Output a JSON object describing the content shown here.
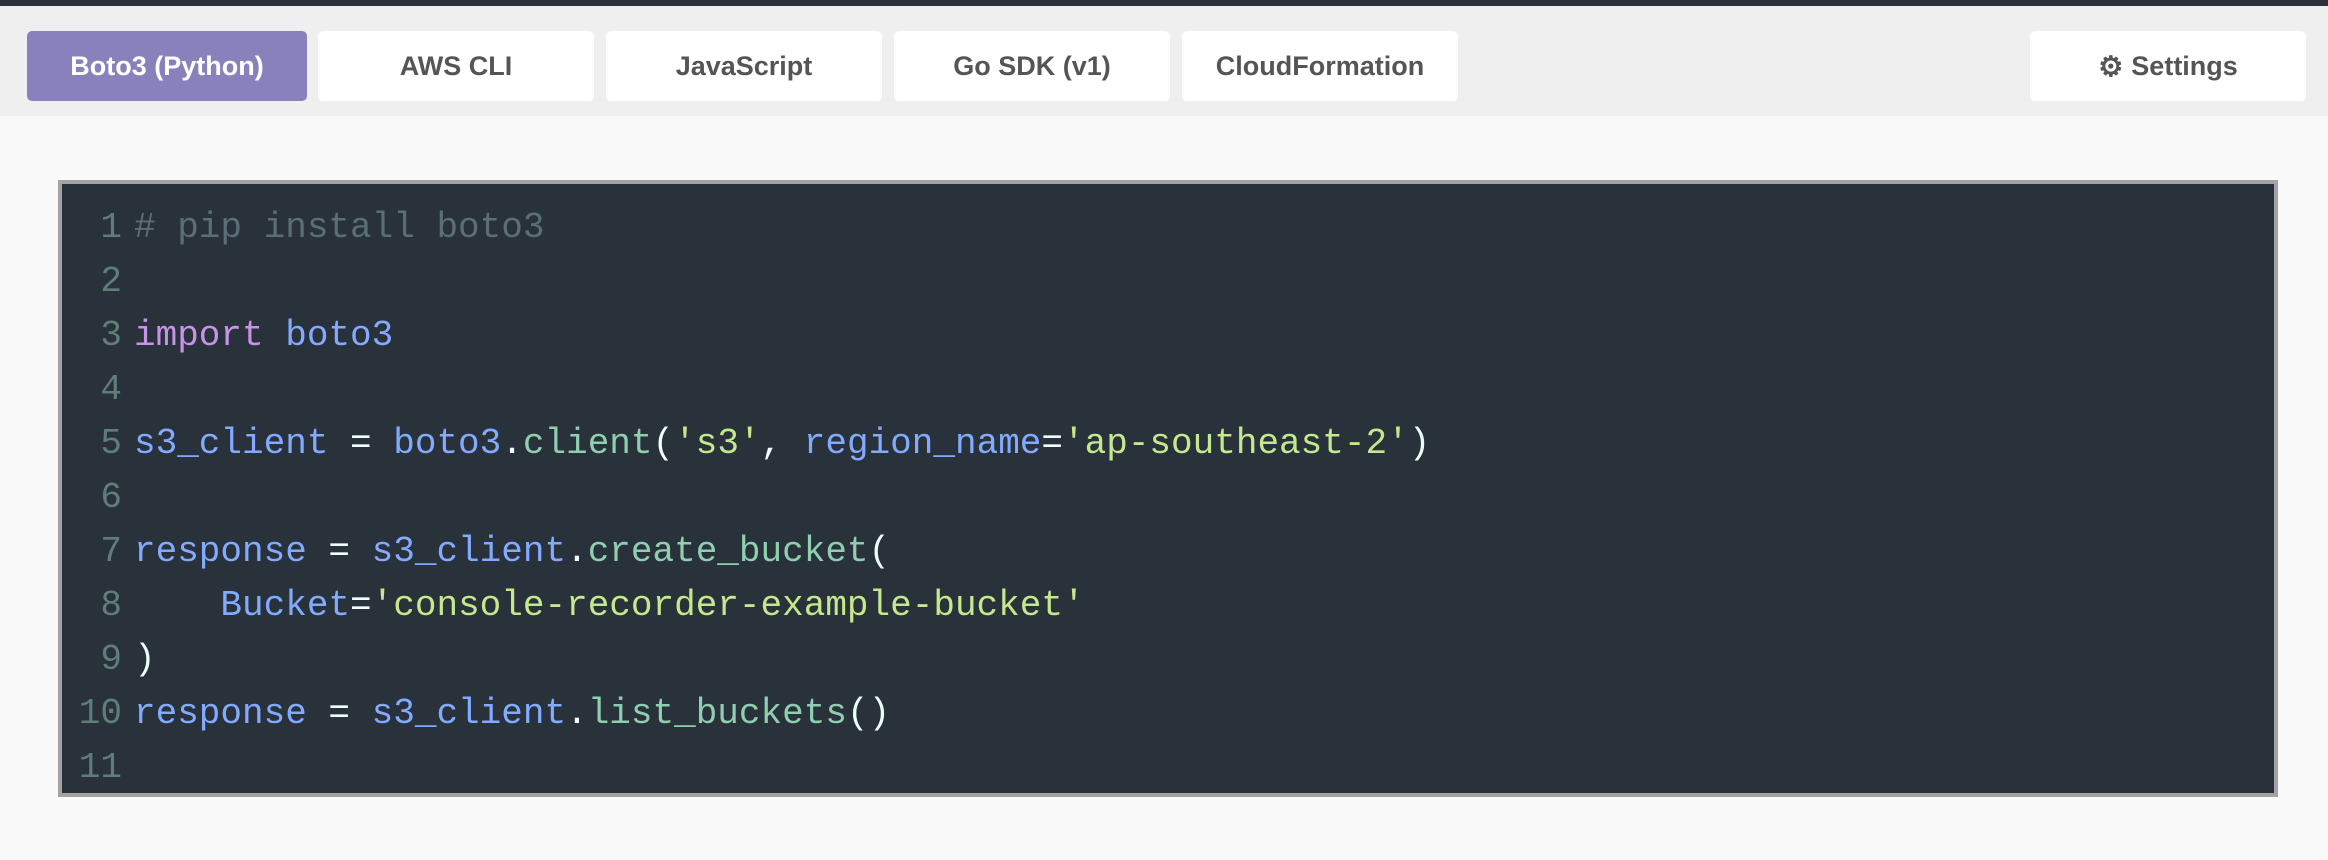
{
  "tabs": [
    {
      "label": "Boto3 (Python)",
      "active": true
    },
    {
      "label": "AWS CLI",
      "active": false
    },
    {
      "label": "JavaScript",
      "active": false
    },
    {
      "label": "Go SDK (v1)",
      "active": false
    },
    {
      "label": "CloudFormation",
      "active": false
    }
  ],
  "settings": {
    "label": "Settings",
    "icon": "gears-icon"
  },
  "code": {
    "lines": [
      [
        [
          "comment",
          "# pip install boto3"
        ]
      ],
      [],
      [
        [
          "kw",
          "import"
        ],
        [
          "punc",
          " "
        ],
        [
          "name",
          "boto3"
        ]
      ],
      [],
      [
        [
          "name",
          "s3_client"
        ],
        [
          "punc",
          " = "
        ],
        [
          "name",
          "boto3"
        ],
        [
          "punc",
          "."
        ],
        [
          "fn",
          "client"
        ],
        [
          "punc",
          "("
        ],
        [
          "str",
          "'s3'"
        ],
        [
          "punc",
          ", "
        ],
        [
          "name",
          "region_name"
        ],
        [
          "punc",
          "="
        ],
        [
          "str",
          "'ap-southeast-2'"
        ],
        [
          "punc",
          ")"
        ]
      ],
      [],
      [
        [
          "name",
          "response"
        ],
        [
          "punc",
          " = "
        ],
        [
          "name",
          "s3_client"
        ],
        [
          "punc",
          "."
        ],
        [
          "fn",
          "create_bucket"
        ],
        [
          "punc",
          "("
        ]
      ],
      [
        [
          "punc",
          "    "
        ],
        [
          "name",
          "Bucket"
        ],
        [
          "punc",
          "="
        ],
        [
          "str",
          "'console-recorder-example-bucket'"
        ]
      ],
      [
        [
          "punc",
          ")"
        ]
      ],
      [
        [
          "name",
          "response"
        ],
        [
          "punc",
          " = "
        ],
        [
          "name",
          "s3_client"
        ],
        [
          "punc",
          "."
        ],
        [
          "fn",
          "list_buckets"
        ],
        [
          "punc",
          "()"
        ]
      ],
      []
    ]
  }
}
